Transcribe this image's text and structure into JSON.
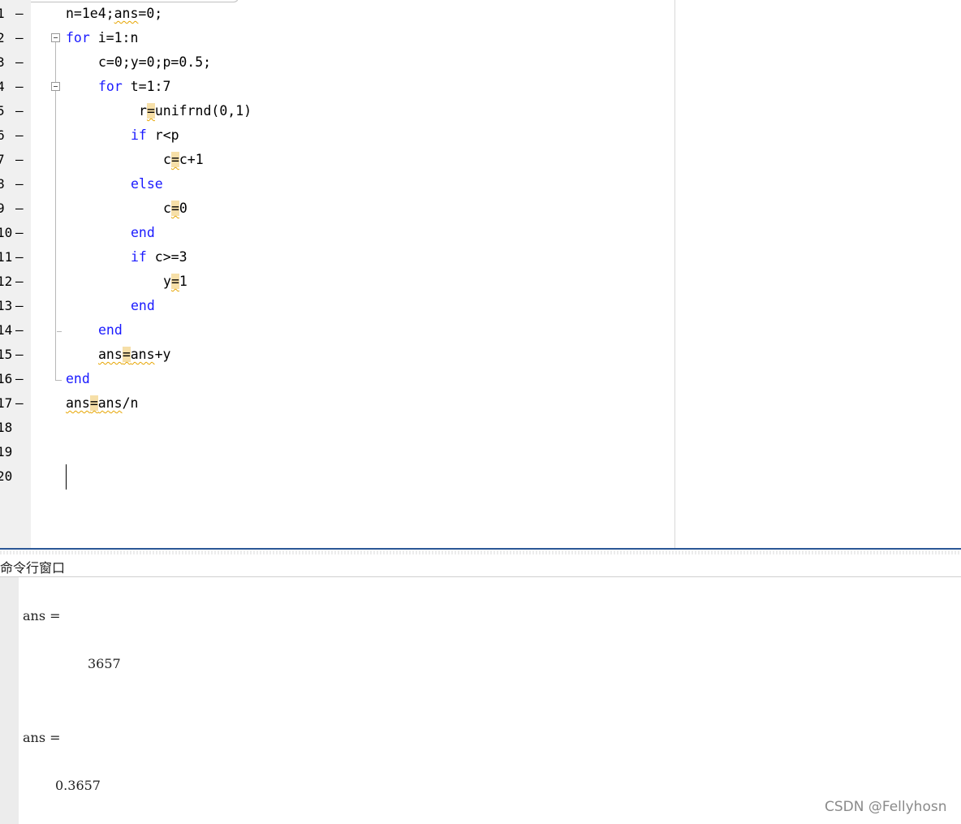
{
  "editor": {
    "lines": [
      {
        "num": "1",
        "dash": true
      },
      {
        "num": "2",
        "dash": true
      },
      {
        "num": "3",
        "dash": true
      },
      {
        "num": "4",
        "dash": true
      },
      {
        "num": "5",
        "dash": true
      },
      {
        "num": "6",
        "dash": true
      },
      {
        "num": "7",
        "dash": true
      },
      {
        "num": "8",
        "dash": true
      },
      {
        "num": "9",
        "dash": true
      },
      {
        "num": "10",
        "dash": true
      },
      {
        "num": "11",
        "dash": true
      },
      {
        "num": "12",
        "dash": true
      },
      {
        "num": "13",
        "dash": true
      },
      {
        "num": "14",
        "dash": true
      },
      {
        "num": "15",
        "dash": true
      },
      {
        "num": "16",
        "dash": true
      },
      {
        "num": "17",
        "dash": true
      },
      {
        "num": "18",
        "dash": false
      },
      {
        "num": "19",
        "dash": false
      },
      {
        "num": "20",
        "dash": false
      }
    ],
    "code": {
      "l1": {
        "a": "n=1e4;",
        "b": "ans",
        "c": "=0;"
      },
      "l2": {
        "kw": "for",
        "rest": " i=1:n"
      },
      "l3": {
        "text": "c=0;y=0;p=0.5;"
      },
      "l4": {
        "kw": "for",
        "rest": " t=1:7"
      },
      "l5": {
        "a": "r",
        "eq": "=",
        "b": "unifrnd(0,1)"
      },
      "l6": {
        "kw": "if",
        "rest": " r<p"
      },
      "l7": {
        "a": "c",
        "eq": "=",
        "b": "c+1"
      },
      "l8": {
        "kw": "else"
      },
      "l9": {
        "a": "c",
        "eq": "=",
        "b": "0"
      },
      "l10": {
        "kw": "end"
      },
      "l11": {
        "kw": "if",
        "rest": " c>=3"
      },
      "l12": {
        "a": "y",
        "eq": "=",
        "b": "1"
      },
      "l13": {
        "kw": "end"
      },
      "l14": {
        "kw": "end"
      },
      "l15": {
        "a": "ans",
        "eq": "=",
        "b": "ans",
        "c": "+y"
      },
      "l16": {
        "kw": "end"
      },
      "l17": {
        "a": "ans",
        "eq": "=",
        "b": "ans",
        "c": "/n"
      }
    },
    "keyword_color": "#1a1aff",
    "highlight_color": "#f6dfa8"
  },
  "command_window": {
    "title": "命令行窗口",
    "outputs": [
      {
        "label": "ans =",
        "value": "3657"
      },
      {
        "label": "ans =",
        "value": "0.3657"
      }
    ]
  },
  "watermark": "CSDN @Fellyhosn",
  "colors": {
    "split_line": "#2b5796",
    "gutter": "#f0f0f0"
  }
}
